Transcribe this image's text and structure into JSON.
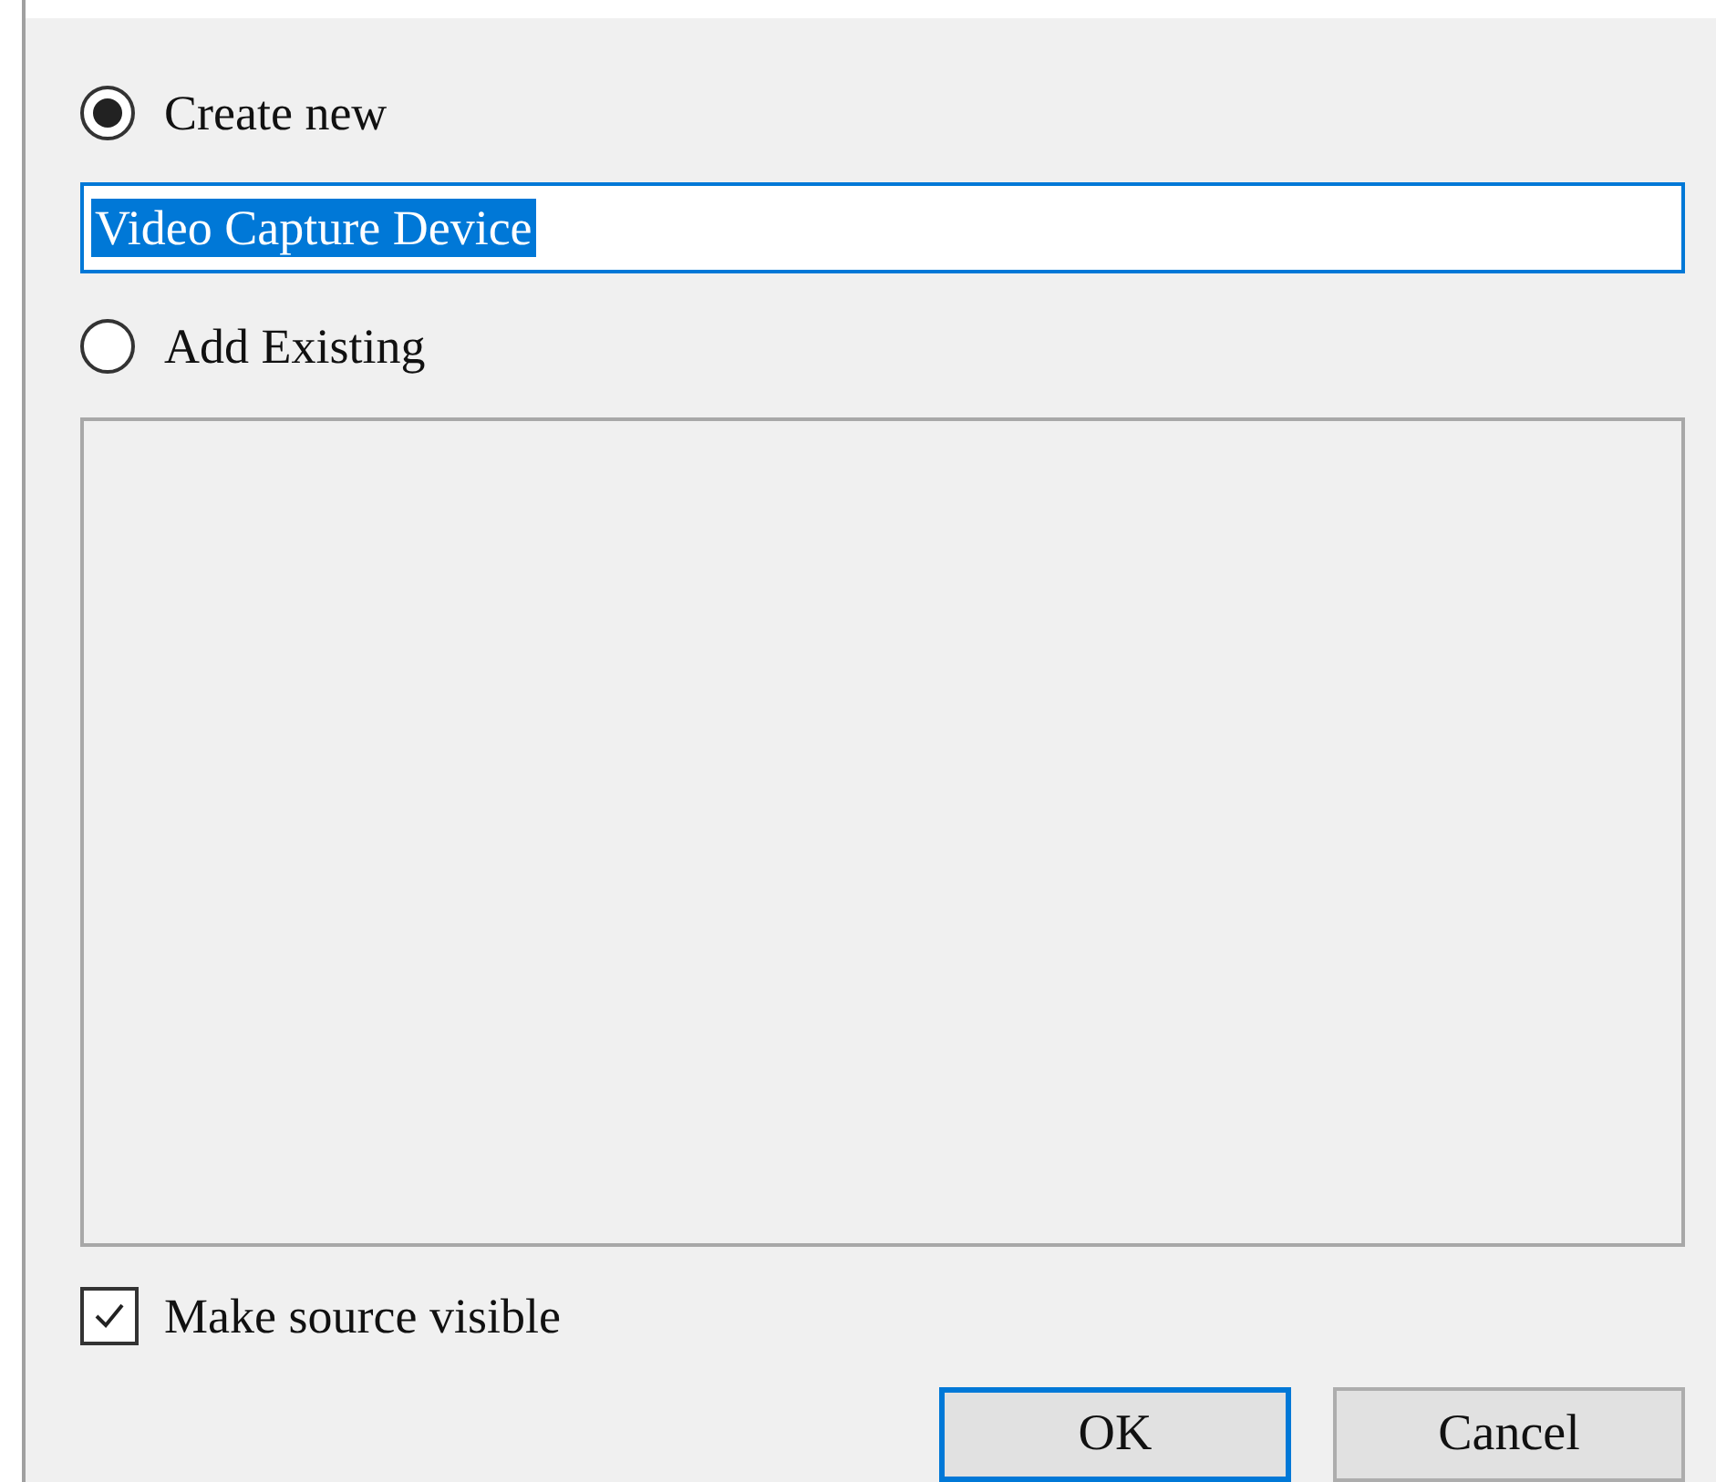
{
  "source_choice": [
    {
      "label": "Create new",
      "selected": true
    },
    {
      "label": "Add Existing",
      "selected": false
    }
  ],
  "name_field": {
    "value": "Video Capture Device",
    "text_selected": true
  },
  "visibility_checkbox": {
    "label": "Make source visible",
    "checked": true
  },
  "buttons": [
    {
      "label": "OK",
      "default": true
    },
    {
      "label": "Cancel",
      "default": false
    }
  ]
}
